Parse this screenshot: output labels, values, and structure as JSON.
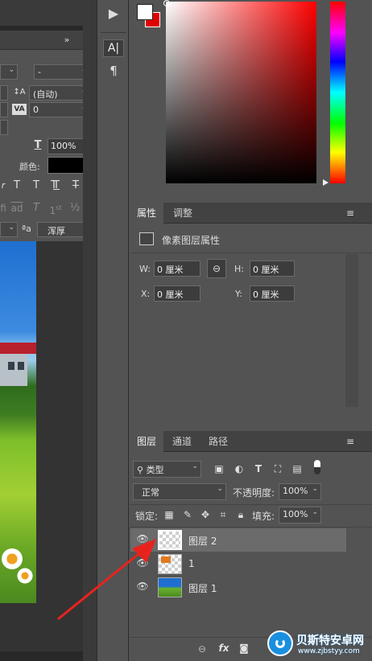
{
  "character_panel": {
    "font_style_value": "-",
    "leading_value": "(自动)",
    "tracking_value": "0",
    "vertical_scale_value": "100%",
    "color_label": "颜色:",
    "style_buttons": [
      "T",
      "T",
      "T",
      "T",
      "T"
    ],
    "opentype_buttons": [
      "fi",
      "ad",
      "T",
      "1st",
      "½"
    ],
    "aa_label": "ªa",
    "antialias_value": "浑厚"
  },
  "tool_strip": {
    "character_icon_label": "A|",
    "paragraph_icon_label": "¶"
  },
  "properties_panel": {
    "tabs": [
      "属性",
      "调整"
    ],
    "section_title": "像素图层属性",
    "w_label": "W:",
    "w_value": "0 厘米",
    "h_label": "H:",
    "h_value": "0 厘米",
    "x_label": "X:",
    "x_value": "0 厘米",
    "y_label": "Y:",
    "y_value": "0 厘米"
  },
  "layers_panel": {
    "tabs": [
      "图层",
      "通道",
      "路径"
    ],
    "filter_type": "类型",
    "blend_mode": "正常",
    "opacity_label": "不透明度:",
    "opacity_value": "100%",
    "lock_label": "锁定:",
    "fill_label": "填充:",
    "fill_value": "100%",
    "layers": [
      {
        "name": "图层 2",
        "selected": true
      },
      {
        "name": "1",
        "selected": false
      },
      {
        "name": "图层 1",
        "selected": false
      }
    ],
    "footer_fx": "fx"
  },
  "colors": {
    "foreground": "#ffffff",
    "background": "#e00000",
    "arrow": "#e8231d"
  },
  "watermark": {
    "brand": "贝斯特安卓网",
    "url": "www.zjbstyy.com"
  }
}
